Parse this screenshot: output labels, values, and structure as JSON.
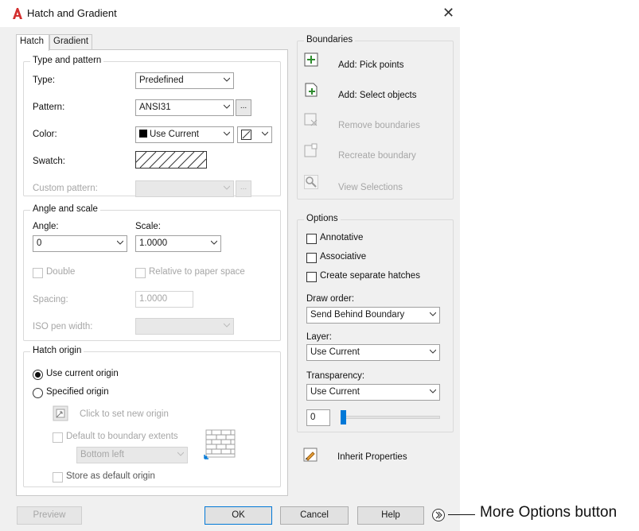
{
  "window": {
    "title": "Hatch and Gradient",
    "close_glyph": "✕"
  },
  "tabs": [
    {
      "label": "Hatch",
      "active": true
    },
    {
      "label": "Gradient",
      "active": false
    }
  ],
  "type_and_pattern": {
    "title": "Type and pattern",
    "type_label": "Type:",
    "type_value": "Predefined",
    "pattern_label": "Pattern:",
    "pattern_value": "ANSI31",
    "pattern_browse": "...",
    "color_label": "Color:",
    "color_value": "Use Current",
    "color_swatch": "#000000",
    "swatch_label": "Swatch:",
    "custom_pattern_label": "Custom pattern:",
    "custom_pattern_value": "",
    "custom_pattern_browse": "..."
  },
  "angle_and_scale": {
    "title": "Angle and scale",
    "angle_label": "Angle:",
    "angle_value": "0",
    "scale_label": "Scale:",
    "scale_value": "1.0000",
    "double_label": "Double",
    "double_checked": false,
    "relative_label": "Relative to paper space",
    "relative_checked": false,
    "spacing_label": "Spacing:",
    "spacing_value": "1.0000",
    "iso_label": "ISO pen width:",
    "iso_value": ""
  },
  "hatch_origin": {
    "title": "Hatch origin",
    "use_current_label": "Use current origin",
    "use_current_selected": true,
    "specified_label": "Specified origin",
    "specified_selected": false,
    "click_to_set_label": "Click to set new origin",
    "default_extents_label": "Default to boundary extents",
    "default_extents_checked": false,
    "extents_value": "Bottom left",
    "store_default_label": "Store as default origin",
    "store_default_checked": false
  },
  "boundaries": {
    "title": "Boundaries",
    "add_pick_points": "Add: Pick points",
    "add_select_objects": "Add: Select objects",
    "remove_boundaries": "Remove boundaries",
    "recreate_boundary": "Recreate boundary",
    "view_selections": "View Selections"
  },
  "options": {
    "title": "Options",
    "annotative_label": "Annotative",
    "annotative_checked": false,
    "associative_label": "Associative",
    "associative_checked": false,
    "separate_label": "Create separate hatches",
    "separate_checked": false,
    "draw_order_label": "Draw order:",
    "draw_order_value": "Send Behind Boundary",
    "layer_label": "Layer:",
    "layer_value": "Use Current",
    "transparency_label": "Transparency:",
    "transparency_value": "Use Current",
    "transparency_amount": "0",
    "transparency_slider_fraction": 0.0
  },
  "inherit_properties": "Inherit Properties",
  "buttons": {
    "preview": "Preview",
    "ok": "OK",
    "cancel": "Cancel",
    "help": "Help"
  },
  "callout": {
    "more_options": "More Options button"
  },
  "colors": {
    "accent": "#0078d7",
    "title_icon": "#d32f2f",
    "pick_icon": "#2e8b2e"
  }
}
